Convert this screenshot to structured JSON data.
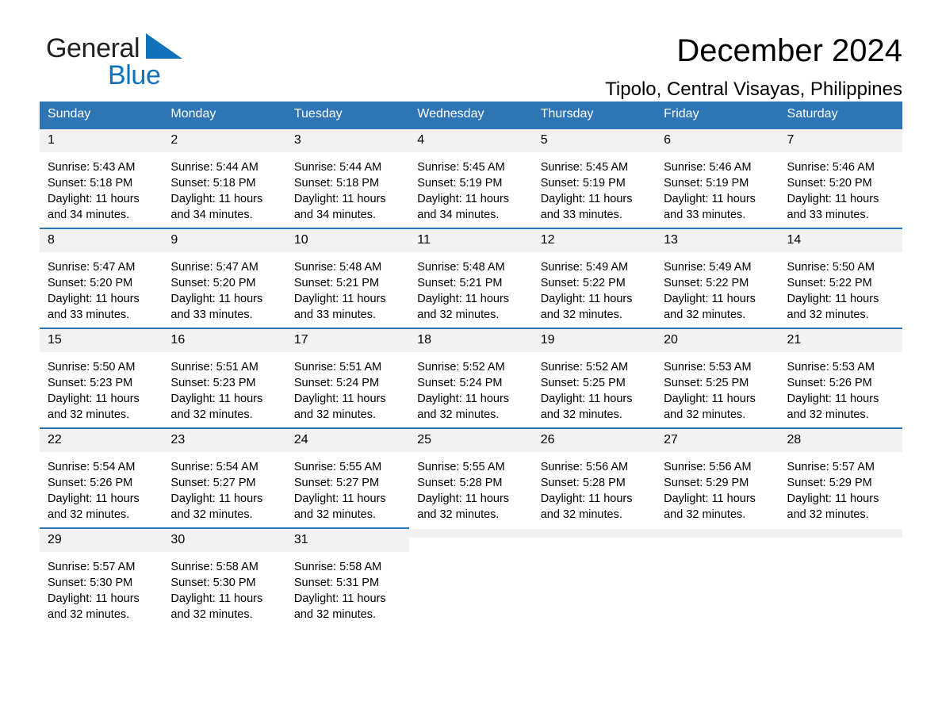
{
  "brand": {
    "word1": "General",
    "word2": "Blue",
    "logo_icon": "triangle-logo-icon",
    "accent_color": "#1072bb"
  },
  "header": {
    "title": "December 2024",
    "subtitle": "Tipolo, Central Visayas, Philippines",
    "header_bg_color": "#2e75b6",
    "daynum_bg_color": "#f2f2f2"
  },
  "calendar": {
    "weekday_headers": [
      "Sunday",
      "Monday",
      "Tuesday",
      "Wednesday",
      "Thursday",
      "Friday",
      "Saturday"
    ],
    "labels": {
      "sunrise": "Sunrise:",
      "sunset": "Sunset:",
      "daylight": "Daylight:"
    },
    "weeks": [
      [
        {
          "day": "1",
          "sunrise": "Sunrise: 5:43 AM",
          "sunset": "Sunset: 5:18 PM",
          "daylight_line1": "Daylight: 11 hours",
          "daylight_line2": "and 34 minutes."
        },
        {
          "day": "2",
          "sunrise": "Sunrise: 5:44 AM",
          "sunset": "Sunset: 5:18 PM",
          "daylight_line1": "Daylight: 11 hours",
          "daylight_line2": "and 34 minutes."
        },
        {
          "day": "3",
          "sunrise": "Sunrise: 5:44 AM",
          "sunset": "Sunset: 5:18 PM",
          "daylight_line1": "Daylight: 11 hours",
          "daylight_line2": "and 34 minutes."
        },
        {
          "day": "4",
          "sunrise": "Sunrise: 5:45 AM",
          "sunset": "Sunset: 5:19 PM",
          "daylight_line1": "Daylight: 11 hours",
          "daylight_line2": "and 34 minutes."
        },
        {
          "day": "5",
          "sunrise": "Sunrise: 5:45 AM",
          "sunset": "Sunset: 5:19 PM",
          "daylight_line1": "Daylight: 11 hours",
          "daylight_line2": "and 33 minutes."
        },
        {
          "day": "6",
          "sunrise": "Sunrise: 5:46 AM",
          "sunset": "Sunset: 5:19 PM",
          "daylight_line1": "Daylight: 11 hours",
          "daylight_line2": "and 33 minutes."
        },
        {
          "day": "7",
          "sunrise": "Sunrise: 5:46 AM",
          "sunset": "Sunset: 5:20 PM",
          "daylight_line1": "Daylight: 11 hours",
          "daylight_line2": "and 33 minutes."
        }
      ],
      [
        {
          "day": "8",
          "sunrise": "Sunrise: 5:47 AM",
          "sunset": "Sunset: 5:20 PM",
          "daylight_line1": "Daylight: 11 hours",
          "daylight_line2": "and 33 minutes."
        },
        {
          "day": "9",
          "sunrise": "Sunrise: 5:47 AM",
          "sunset": "Sunset: 5:20 PM",
          "daylight_line1": "Daylight: 11 hours",
          "daylight_line2": "and 33 minutes."
        },
        {
          "day": "10",
          "sunrise": "Sunrise: 5:48 AM",
          "sunset": "Sunset: 5:21 PM",
          "daylight_line1": "Daylight: 11 hours",
          "daylight_line2": "and 33 minutes."
        },
        {
          "day": "11",
          "sunrise": "Sunrise: 5:48 AM",
          "sunset": "Sunset: 5:21 PM",
          "daylight_line1": "Daylight: 11 hours",
          "daylight_line2": "and 32 minutes."
        },
        {
          "day": "12",
          "sunrise": "Sunrise: 5:49 AM",
          "sunset": "Sunset: 5:22 PM",
          "daylight_line1": "Daylight: 11 hours",
          "daylight_line2": "and 32 minutes."
        },
        {
          "day": "13",
          "sunrise": "Sunrise: 5:49 AM",
          "sunset": "Sunset: 5:22 PM",
          "daylight_line1": "Daylight: 11 hours",
          "daylight_line2": "and 32 minutes."
        },
        {
          "day": "14",
          "sunrise": "Sunrise: 5:50 AM",
          "sunset": "Sunset: 5:22 PM",
          "daylight_line1": "Daylight: 11 hours",
          "daylight_line2": "and 32 minutes."
        }
      ],
      [
        {
          "day": "15",
          "sunrise": "Sunrise: 5:50 AM",
          "sunset": "Sunset: 5:23 PM",
          "daylight_line1": "Daylight: 11 hours",
          "daylight_line2": "and 32 minutes."
        },
        {
          "day": "16",
          "sunrise": "Sunrise: 5:51 AM",
          "sunset": "Sunset: 5:23 PM",
          "daylight_line1": "Daylight: 11 hours",
          "daylight_line2": "and 32 minutes."
        },
        {
          "day": "17",
          "sunrise": "Sunrise: 5:51 AM",
          "sunset": "Sunset: 5:24 PM",
          "daylight_line1": "Daylight: 11 hours",
          "daylight_line2": "and 32 minutes."
        },
        {
          "day": "18",
          "sunrise": "Sunrise: 5:52 AM",
          "sunset": "Sunset: 5:24 PM",
          "daylight_line1": "Daylight: 11 hours",
          "daylight_line2": "and 32 minutes."
        },
        {
          "day": "19",
          "sunrise": "Sunrise: 5:52 AM",
          "sunset": "Sunset: 5:25 PM",
          "daylight_line1": "Daylight: 11 hours",
          "daylight_line2": "and 32 minutes."
        },
        {
          "day": "20",
          "sunrise": "Sunrise: 5:53 AM",
          "sunset": "Sunset: 5:25 PM",
          "daylight_line1": "Daylight: 11 hours",
          "daylight_line2": "and 32 minutes."
        },
        {
          "day": "21",
          "sunrise": "Sunrise: 5:53 AM",
          "sunset": "Sunset: 5:26 PM",
          "daylight_line1": "Daylight: 11 hours",
          "daylight_line2": "and 32 minutes."
        }
      ],
      [
        {
          "day": "22",
          "sunrise": "Sunrise: 5:54 AM",
          "sunset": "Sunset: 5:26 PM",
          "daylight_line1": "Daylight: 11 hours",
          "daylight_line2": "and 32 minutes."
        },
        {
          "day": "23",
          "sunrise": "Sunrise: 5:54 AM",
          "sunset": "Sunset: 5:27 PM",
          "daylight_line1": "Daylight: 11 hours",
          "daylight_line2": "and 32 minutes."
        },
        {
          "day": "24",
          "sunrise": "Sunrise: 5:55 AM",
          "sunset": "Sunset: 5:27 PM",
          "daylight_line1": "Daylight: 11 hours",
          "daylight_line2": "and 32 minutes."
        },
        {
          "day": "25",
          "sunrise": "Sunrise: 5:55 AM",
          "sunset": "Sunset: 5:28 PM",
          "daylight_line1": "Daylight: 11 hours",
          "daylight_line2": "and 32 minutes."
        },
        {
          "day": "26",
          "sunrise": "Sunrise: 5:56 AM",
          "sunset": "Sunset: 5:28 PM",
          "daylight_line1": "Daylight: 11 hours",
          "daylight_line2": "and 32 minutes."
        },
        {
          "day": "27",
          "sunrise": "Sunrise: 5:56 AM",
          "sunset": "Sunset: 5:29 PM",
          "daylight_line1": "Daylight: 11 hours",
          "daylight_line2": "and 32 minutes."
        },
        {
          "day": "28",
          "sunrise": "Sunrise: 5:57 AM",
          "sunset": "Sunset: 5:29 PM",
          "daylight_line1": "Daylight: 11 hours",
          "daylight_line2": "and 32 minutes."
        }
      ],
      [
        {
          "day": "29",
          "sunrise": "Sunrise: 5:57 AM",
          "sunset": "Sunset: 5:30 PM",
          "daylight_line1": "Daylight: 11 hours",
          "daylight_line2": "and 32 minutes."
        },
        {
          "day": "30",
          "sunrise": "Sunrise: 5:58 AM",
          "sunset": "Sunset: 5:30 PM",
          "daylight_line1": "Daylight: 11 hours",
          "daylight_line2": "and 32 minutes."
        },
        {
          "day": "31",
          "sunrise": "Sunrise: 5:58 AM",
          "sunset": "Sunset: 5:31 PM",
          "daylight_line1": "Daylight: 11 hours",
          "daylight_line2": "and 32 minutes."
        },
        {
          "day": "",
          "sunrise": "",
          "sunset": "",
          "daylight_line1": "",
          "daylight_line2": "",
          "empty": true
        },
        {
          "day": "",
          "sunrise": "",
          "sunset": "",
          "daylight_line1": "",
          "daylight_line2": "",
          "empty": true
        },
        {
          "day": "",
          "sunrise": "",
          "sunset": "",
          "daylight_line1": "",
          "daylight_line2": "",
          "empty": true
        },
        {
          "day": "",
          "sunrise": "",
          "sunset": "",
          "daylight_line1": "",
          "daylight_line2": "",
          "empty": true
        }
      ]
    ]
  }
}
